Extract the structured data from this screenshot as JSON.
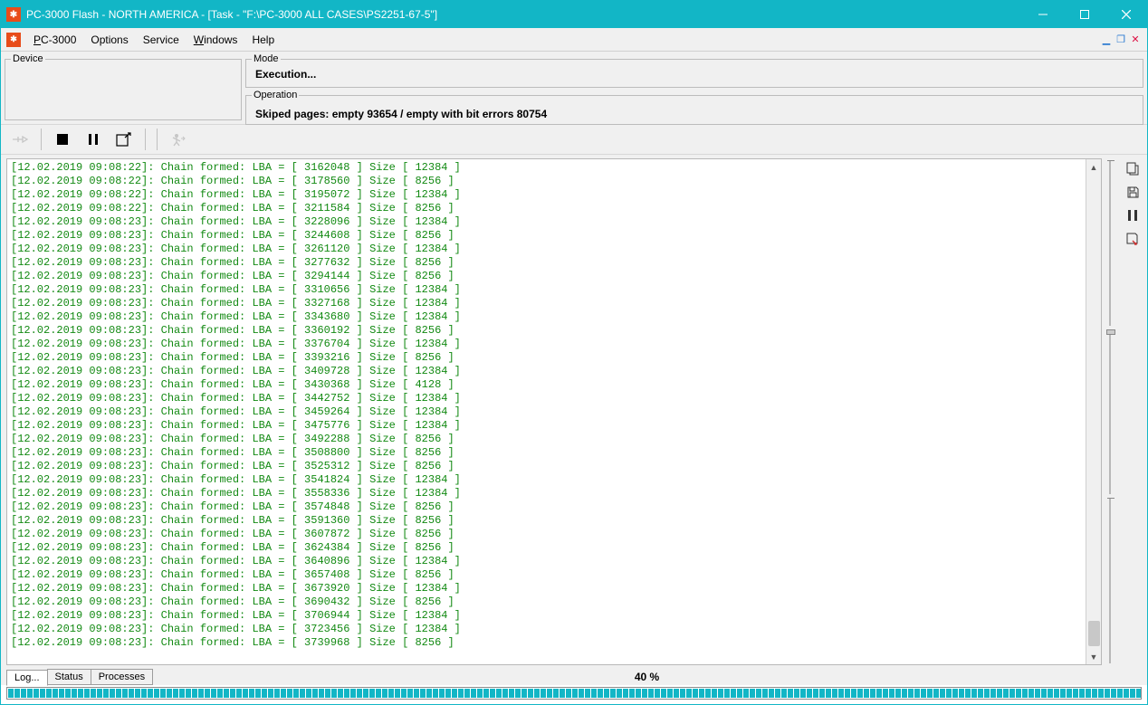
{
  "window": {
    "title": "PC-3000 Flash - NORTH AMERICA - [Task - \"F:\\PC-3000 ALL CASES\\PS2251-67-5\"]"
  },
  "menu": {
    "pc3000": "PC-3000",
    "options": "Options",
    "service": "Service",
    "windows": "Windows",
    "help": "Help"
  },
  "panels": {
    "device_label": "Device",
    "mode_label": "Mode",
    "mode_value": "Execution...",
    "operation_label": "Operation",
    "operation_value": "Skiped pages: empty 93654 / empty with bit errors 80754"
  },
  "tabs": {
    "log": "Log...",
    "status": "Status",
    "processes": "Processes"
  },
  "progress": {
    "label": "40 %",
    "percent": 40
  },
  "log_entries": [
    {
      "ts": "12.02.2019 09:08:22",
      "lba": "3162048",
      "size": "12384"
    },
    {
      "ts": "12.02.2019 09:08:22",
      "lba": "3178560",
      "size": "8256"
    },
    {
      "ts": "12.02.2019 09:08:22",
      "lba": "3195072",
      "size": "12384"
    },
    {
      "ts": "12.02.2019 09:08:22",
      "lba": "3211584",
      "size": "8256"
    },
    {
      "ts": "12.02.2019 09:08:23",
      "lba": "3228096",
      "size": "12384"
    },
    {
      "ts": "12.02.2019 09:08:23",
      "lba": "3244608",
      "size": "8256"
    },
    {
      "ts": "12.02.2019 09:08:23",
      "lba": "3261120",
      "size": "12384"
    },
    {
      "ts": "12.02.2019 09:08:23",
      "lba": "3277632",
      "size": "8256"
    },
    {
      "ts": "12.02.2019 09:08:23",
      "lba": "3294144",
      "size": "8256"
    },
    {
      "ts": "12.02.2019 09:08:23",
      "lba": "3310656",
      "size": "12384"
    },
    {
      "ts": "12.02.2019 09:08:23",
      "lba": "3327168",
      "size": "12384"
    },
    {
      "ts": "12.02.2019 09:08:23",
      "lba": "3343680",
      "size": "12384"
    },
    {
      "ts": "12.02.2019 09:08:23",
      "lba": "3360192",
      "size": "8256"
    },
    {
      "ts": "12.02.2019 09:08:23",
      "lba": "3376704",
      "size": "12384"
    },
    {
      "ts": "12.02.2019 09:08:23",
      "lba": "3393216",
      "size": "8256"
    },
    {
      "ts": "12.02.2019 09:08:23",
      "lba": "3409728",
      "size": "12384"
    },
    {
      "ts": "12.02.2019 09:08:23",
      "lba": "3430368",
      "size": "4128"
    },
    {
      "ts": "12.02.2019 09:08:23",
      "lba": "3442752",
      "size": "12384"
    },
    {
      "ts": "12.02.2019 09:08:23",
      "lba": "3459264",
      "size": "12384"
    },
    {
      "ts": "12.02.2019 09:08:23",
      "lba": "3475776",
      "size": "12384"
    },
    {
      "ts": "12.02.2019 09:08:23",
      "lba": "3492288",
      "size": "8256"
    },
    {
      "ts": "12.02.2019 09:08:23",
      "lba": "3508800",
      "size": "8256"
    },
    {
      "ts": "12.02.2019 09:08:23",
      "lba": "3525312",
      "size": "8256"
    },
    {
      "ts": "12.02.2019 09:08:23",
      "lba": "3541824",
      "size": "12384"
    },
    {
      "ts": "12.02.2019 09:08:23",
      "lba": "3558336",
      "size": "12384"
    },
    {
      "ts": "12.02.2019 09:08:23",
      "lba": "3574848",
      "size": "8256"
    },
    {
      "ts": "12.02.2019 09:08:23",
      "lba": "3591360",
      "size": "8256"
    },
    {
      "ts": "12.02.2019 09:08:23",
      "lba": "3607872",
      "size": "8256"
    },
    {
      "ts": "12.02.2019 09:08:23",
      "lba": "3624384",
      "size": "8256"
    },
    {
      "ts": "12.02.2019 09:08:23",
      "lba": "3640896",
      "size": "12384"
    },
    {
      "ts": "12.02.2019 09:08:23",
      "lba": "3657408",
      "size": "8256"
    },
    {
      "ts": "12.02.2019 09:08:23",
      "lba": "3673920",
      "size": "12384"
    },
    {
      "ts": "12.02.2019 09:08:23",
      "lba": "3690432",
      "size": "8256"
    },
    {
      "ts": "12.02.2019 09:08:23",
      "lba": "3706944",
      "size": "12384"
    },
    {
      "ts": "12.02.2019 09:08:23",
      "lba": "3723456",
      "size": "12384"
    },
    {
      "ts": "12.02.2019 09:08:23",
      "lba": "3739968",
      "size": "8256"
    }
  ]
}
